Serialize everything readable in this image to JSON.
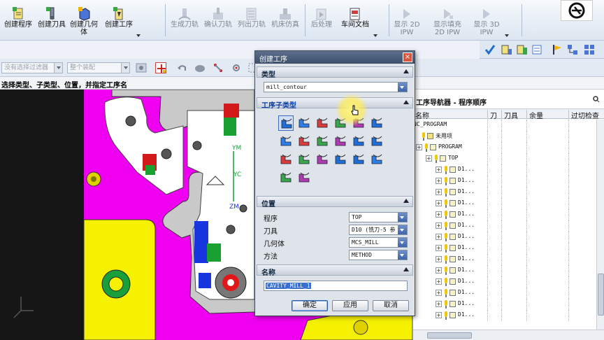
{
  "ribbon": {
    "groups": [
      {
        "buttons": [
          {
            "label": "创建程序",
            "icon": "create-program-icon",
            "enabled": true
          },
          {
            "label": "创建刀具",
            "icon": "create-tool-icon",
            "enabled": true
          },
          {
            "label": "创建几何",
            "label2": "体",
            "icon": "create-geometry-icon",
            "enabled": true
          },
          {
            "label": "创建工序",
            "icon": "create-operation-icon",
            "enabled": true
          }
        ]
      },
      {
        "buttons": [
          {
            "label": "生成刀轨",
            "icon": "generate-toolpath-icon",
            "enabled": false
          },
          {
            "label": "确认刀轨",
            "icon": "verify-toolpath-icon",
            "enabled": false
          },
          {
            "label": "列出刀轨",
            "icon": "list-toolpath-icon",
            "enabled": false
          },
          {
            "label": "机床仿真",
            "icon": "machine-simulation-icon",
            "enabled": false
          }
        ]
      },
      {
        "buttons": [
          {
            "label": "后处理",
            "icon": "postprocess-icon",
            "enabled": false
          },
          {
            "label": "车间文档",
            "icon": "shop-documentation-icon",
            "enabled": true
          }
        ]
      },
      {
        "buttons": [
          {
            "label": "显示 2D",
            "label2": "IPW",
            "icon": "display-2d-ipw-icon",
            "enabled": false
          },
          {
            "label": "显示填充",
            "label2": "2D IPW",
            "icon": "display-fill-2d-ipw-icon",
            "enabled": false
          },
          {
            "label": "显示 3D",
            "label2": "IPW",
            "icon": "display-3d-ipw-icon",
            "enabled": false
          }
        ]
      }
    ]
  },
  "filterbar": {
    "selection_filter": "没有选择过滤器",
    "assembly_scope": "整个装配"
  },
  "cue_line": "选择类型、子类型、位置，并指定工序名",
  "dialog": {
    "title": "创建工序",
    "sections": {
      "type": "类型",
      "subtype": "工序子类型",
      "location": "位置",
      "name": "名称"
    },
    "type_value": "mill_contour",
    "location_fields": [
      {
        "label": "程序",
        "value": "TOP"
      },
      {
        "label": "刀具",
        "value": "D10 (铣刀-5 参"
      },
      {
        "label": "几何体",
        "value": "MCS_MILL"
      },
      {
        "label": "方法",
        "value": "METHOD"
      }
    ],
    "name_value": "CAVITY_MILL_1",
    "buttons": {
      "ok": "确定",
      "apply": "应用",
      "cancel": "取消"
    },
    "close": "×"
  },
  "navigator": {
    "title": "工序导航器 - 程序顺序",
    "columns": [
      "名称",
      "刀",
      "刀具",
      "余量",
      "过切检查"
    ],
    "root": "NC_PROGRAM",
    "unused": "未用项",
    "program": "PROGRAM",
    "group": "TOP",
    "operation_label": "D1..."
  },
  "colors": {
    "magenta": "#f000f0",
    "yellow": "#f6f100",
    "part_gray": "#c9c9c9",
    "dialog_bg": "#dfe3ea",
    "ribbon_bg": "#e4ebf4",
    "accent_blue": "#3a6fd0"
  }
}
